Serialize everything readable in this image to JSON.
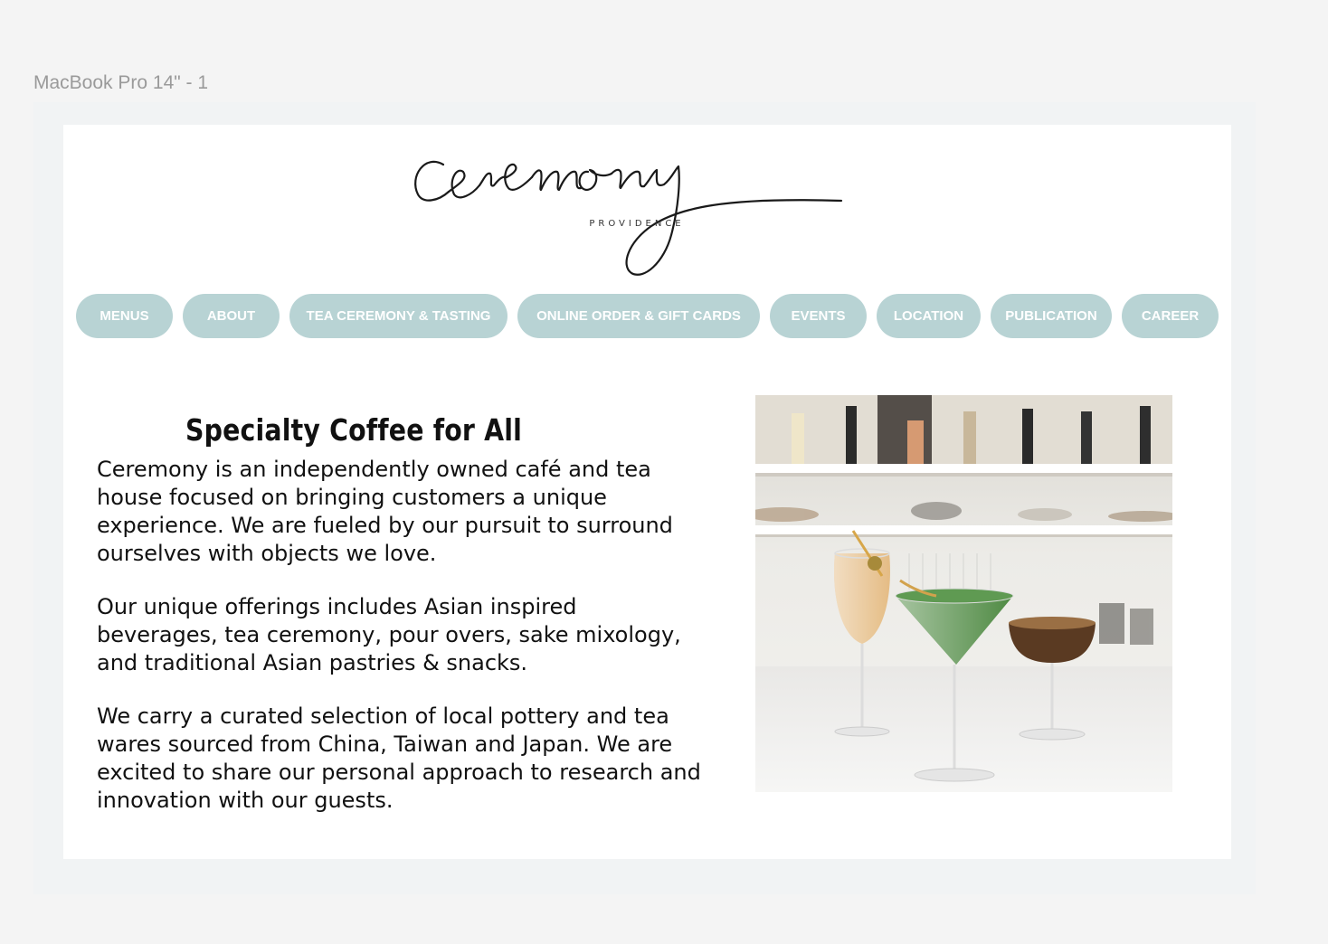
{
  "frame": {
    "label": "MacBook Pro 14\" - 1"
  },
  "brand": {
    "logo_text": "ceremony",
    "logo_subtext": "PROVIDENCE"
  },
  "nav": {
    "items": [
      {
        "label": "MENUS"
      },
      {
        "label": "ABOUT"
      },
      {
        "label": "TEA CEREMONY & TASTING"
      },
      {
        "label": "ONLINE ORDER & GIFT CARDS"
      },
      {
        "label": "EVENTS"
      },
      {
        "label": "LOCATION"
      },
      {
        "label": "PUBLICATION"
      },
      {
        "label": "CAREER"
      }
    ]
  },
  "main": {
    "title": "Specialty Coffee for All",
    "paragraphs": [
      "Ceremony is an independently owned café and tea house focused on bringing customers a unique experience. We are fueled by our pursuit to surround ourselves with objects we love.",
      "Our unique offerings includes Asian inspired beverages, tea ceremony, pour overs, sake mixology, and traditional Asian pastries & snacks.",
      "We carry a curated selection of local pottery and tea wares sourced from China, Taiwan and Japan. We are excited to share our personal approach to research and innovation with our guests."
    ]
  },
  "colors": {
    "nav_pill": "#b8d3d4",
    "nav_text": "#ffffff",
    "page_bg": "#ffffff",
    "canvas_bg": "#f4f4f4"
  }
}
